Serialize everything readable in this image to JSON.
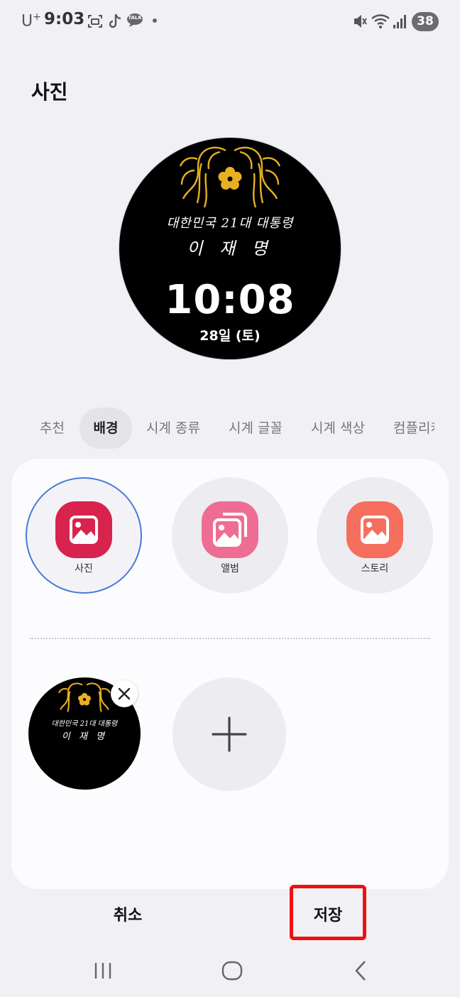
{
  "status_bar": {
    "carrier": "U",
    "carrier_plus": "+",
    "time": "9:03",
    "notification_icons": [
      "screenshot-icon",
      "tiktok-icon",
      "kakaotalk-icon",
      "dot-icon"
    ],
    "kakao_label": "TALK",
    "right_icons": [
      "mute-icon",
      "wifi-icon",
      "signal-icon"
    ],
    "battery": "38"
  },
  "page": {
    "title": "사진"
  },
  "watch_preview": {
    "handwriting_line1": "대한민국 21대 대통령",
    "handwriting_line2": "이 재 명",
    "time": "10:08",
    "date": "28일 (토)"
  },
  "tabs": [
    {
      "label": "추천",
      "active": false
    },
    {
      "label": "배경",
      "active": true
    },
    {
      "label": "시계 종류",
      "active": false
    },
    {
      "label": "시계 글꼴",
      "active": false
    },
    {
      "label": "시계 색상",
      "active": false
    },
    {
      "label": "컴플리케이션",
      "active": false
    }
  ],
  "sources": [
    {
      "label": "사진",
      "icon": "gallery-icon",
      "color": "#d8234e",
      "selected": true
    },
    {
      "label": "앨범",
      "icon": "album-icon",
      "color": "#ee6d95",
      "selected": false
    },
    {
      "label": "스토리",
      "icon": "story-icon",
      "color": "#f56e5e",
      "selected": false
    }
  ],
  "thumbnail": {
    "line1": "대한민국 21대 대통령",
    "line2": "이 재 명"
  },
  "actions": {
    "cancel": "취소",
    "save": "저장"
  },
  "colors": {
    "background": "#f1f1f5",
    "selection_ring": "#4a78d8",
    "highlight_box": "#ee1111",
    "emblem_gold": "#e8b020"
  }
}
